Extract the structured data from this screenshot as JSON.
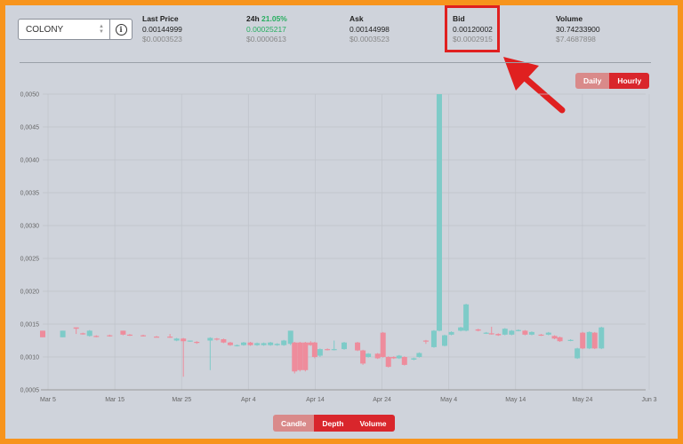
{
  "selector": {
    "value": "COLONY",
    "info_icon": "info-icon"
  },
  "stats": [
    {
      "label": "Last Price",
      "pct": "",
      "value": "0.00144999",
      "usd": "$0.0003523"
    },
    {
      "label": "24h",
      "pct": "21.05%",
      "value": "0.00025217",
      "usd": "$0.0000613"
    },
    {
      "label": "Ask",
      "pct": "",
      "value": "0.00144998",
      "usd": "$0.0003523"
    },
    {
      "label": "Bid",
      "pct": "",
      "value": "0.00120002",
      "usd": "$0.0002915"
    },
    {
      "label": "Volume",
      "pct": "",
      "value": "30.74233900",
      "usd": "$7.4687898"
    }
  ],
  "period_toggle": {
    "daily": "Daily",
    "hourly": "Hourly",
    "active": "Hourly"
  },
  "view_toggle": {
    "candle": "Candle",
    "depth": "Depth",
    "volume": "Volume",
    "active": "Depth"
  },
  "colors": {
    "up": "#7ecbc8",
    "down": "#ee8c9c",
    "accent": "#d9262c",
    "border": "#f7941d"
  },
  "chart_data": {
    "type": "candlestick",
    "y_ticks": [
      "0,0005",
      "0,0010",
      "0,0015",
      "0,0020",
      "0,0025",
      "0,0030",
      "0,0035",
      "0,0040",
      "0,0045",
      "0,0050"
    ],
    "x_ticks": [
      "Mar 5",
      "Mar 15",
      "Mar 25",
      "Apr 4",
      "Apr 14",
      "Apr 24",
      "May 4",
      "May 14",
      "May 24",
      "Jun 3"
    ],
    "ylim": [
      0.0005,
      0.005
    ],
    "xlim": [
      0,
      90
    ],
    "grid": true,
    "candles": [
      {
        "x": 0,
        "o": 0.0014,
        "c": 0.0013,
        "h": 0.0014,
        "l": 0.0013
      },
      {
        "x": 3,
        "o": 0.0013,
        "c": 0.0014,
        "h": 0.0014,
        "l": 0.0013
      },
      {
        "x": 5,
        "o": 0.00145,
        "c": 0.00143,
        "h": 0.00145,
        "l": 0.00135
      },
      {
        "x": 6,
        "o": 0.00136,
        "c": 0.00135,
        "h": 0.00137,
        "l": 0.00134
      },
      {
        "x": 7,
        "o": 0.00132,
        "c": 0.0014,
        "h": 0.00141,
        "l": 0.00131
      },
      {
        "x": 8,
        "o": 0.00132,
        "c": 0.00131,
        "h": 0.00133,
        "l": 0.0013
      },
      {
        "x": 10,
        "o": 0.00133,
        "c": 0.00132,
        "h": 0.00134,
        "l": 0.00131
      },
      {
        "x": 12,
        "o": 0.0014,
        "c": 0.00134,
        "h": 0.0014,
        "l": 0.00133
      },
      {
        "x": 13,
        "o": 0.00134,
        "c": 0.00133,
        "h": 0.00135,
        "l": 0.00132
      },
      {
        "x": 15,
        "o": 0.00133,
        "c": 0.00132,
        "h": 0.00134,
        "l": 0.00131
      },
      {
        "x": 17,
        "o": 0.00131,
        "c": 0.0013,
        "h": 0.00132,
        "l": 0.0013
      },
      {
        "x": 19,
        "o": 0.00131,
        "c": 0.0013,
        "h": 0.00135,
        "l": 0.00129
      },
      {
        "x": 20,
        "o": 0.00125,
        "c": 0.00128,
        "h": 0.00129,
        "l": 0.00124
      },
      {
        "x": 21,
        "o": 0.00128,
        "c": 0.00124,
        "h": 0.00129,
        "l": 0.0007
      },
      {
        "x": 22,
        "o": 0.00124,
        "c": 0.00125,
        "h": 0.00125,
        "l": 0.00123
      },
      {
        "x": 23,
        "o": 0.00123,
        "c": 0.00122,
        "h": 0.00124,
        "l": 0.0012
      },
      {
        "x": 25,
        "o": 0.00125,
        "c": 0.00129,
        "h": 0.0013,
        "l": 0.0008
      },
      {
        "x": 26,
        "o": 0.00128,
        "c": 0.00127,
        "h": 0.00129,
        "l": 0.00125
      },
      {
        "x": 27,
        "o": 0.00127,
        "c": 0.00122,
        "h": 0.00128,
        "l": 0.00121
      },
      {
        "x": 28,
        "o": 0.00122,
        "c": 0.00118,
        "h": 0.00123,
        "l": 0.00117
      },
      {
        "x": 29,
        "o": 0.00117,
        "c": 0.00118,
        "h": 0.00119,
        "l": 0.00116
      },
      {
        "x": 30,
        "o": 0.00118,
        "c": 0.00122,
        "h": 0.00123,
        "l": 0.00117
      },
      {
        "x": 31,
        "o": 0.00122,
        "c": 0.00118,
        "h": 0.00123,
        "l": 0.00117
      },
      {
        "x": 32,
        "o": 0.00118,
        "c": 0.00121,
        "h": 0.00122,
        "l": 0.00117
      },
      {
        "x": 33,
        "o": 0.00118,
        "c": 0.00121,
        "h": 0.00122,
        "l": 0.00117
      },
      {
        "x": 34,
        "o": 0.00118,
        "c": 0.00122,
        "h": 0.00123,
        "l": 0.00117
      },
      {
        "x": 35,
        "o": 0.00118,
        "c": 0.0012,
        "h": 0.00121,
        "l": 0.00117
      },
      {
        "x": 36,
        "o": 0.00118,
        "c": 0.00125,
        "h": 0.00126,
        "l": 0.00117
      },
      {
        "x": 37,
        "o": 0.0012,
        "c": 0.0014,
        "h": 0.0014,
        "l": 0.00118
      },
      {
        "x": 37.6,
        "o": 0.00122,
        "c": 0.00078,
        "h": 0.00123,
        "l": 0.00075
      },
      {
        "x": 38.4,
        "o": 0.00122,
        "c": 0.0008,
        "h": 0.00123,
        "l": 0.00078
      },
      {
        "x": 39.2,
        "o": 0.00122,
        "c": 0.0008,
        "h": 0.00123,
        "l": 0.00078
      },
      {
        "x": 40,
        "o": 0.00122,
        "c": 0.00118,
        "h": 0.00124,
        "l": 0.00117
      },
      {
        "x": 40.6,
        "o": 0.00122,
        "c": 0.001,
        "h": 0.00123,
        "l": 0.00098
      },
      {
        "x": 41.4,
        "o": 0.00102,
        "c": 0.00112,
        "h": 0.00113,
        "l": 0.001
      },
      {
        "x": 42.5,
        "o": 0.00112,
        "c": 0.00111,
        "h": 0.00113,
        "l": 0.0011
      },
      {
        "x": 43.5,
        "o": 0.00111,
        "c": 0.00112,
        "h": 0.00125,
        "l": 0.0011
      },
      {
        "x": 45,
        "o": 0.00112,
        "c": 0.00122,
        "h": 0.00123,
        "l": 0.00111
      },
      {
        "x": 47,
        "o": 0.00122,
        "c": 0.0011,
        "h": 0.00123,
        "l": 0.00109
      },
      {
        "x": 47.8,
        "o": 0.0011,
        "c": 0.0009,
        "h": 0.00111,
        "l": 0.00088
      },
      {
        "x": 48.6,
        "o": 0.001,
        "c": 0.00105,
        "h": 0.00106,
        "l": 0.00099
      },
      {
        "x": 50,
        "o": 0.00105,
        "c": 0.00098,
        "h": 0.00106,
        "l": 0.00097
      },
      {
        "x": 50.8,
        "o": 0.00137,
        "c": 0.001,
        "h": 0.00138,
        "l": 0.00099
      },
      {
        "x": 51.6,
        "o": 0.001,
        "c": 0.00085,
        "h": 0.00101,
        "l": 0.00084
      },
      {
        "x": 52.4,
        "o": 0.001,
        "c": 0.00098,
        "h": 0.00101,
        "l": 0.00097
      },
      {
        "x": 53.2,
        "o": 0.00098,
        "c": 0.00102,
        "h": 0.00103,
        "l": 0.00097
      },
      {
        "x": 54,
        "o": 0.001,
        "c": 0.00088,
        "h": 0.00101,
        "l": 0.00087
      },
      {
        "x": 55.4,
        "o": 0.00096,
        "c": 0.00098,
        "h": 0.00099,
        "l": 0.00095
      },
      {
        "x": 56.2,
        "o": 0.001,
        "c": 0.00106,
        "h": 0.00107,
        "l": 0.00099
      },
      {
        "x": 57.2,
        "o": 0.00125,
        "c": 0.00124,
        "h": 0.00126,
        "l": 0.0012
      },
      {
        "x": 58.4,
        "o": 0.00115,
        "c": 0.0014,
        "h": 0.00141,
        "l": 0.00114
      },
      {
        "x": 59.2,
        "o": 0.0014,
        "c": 0.005,
        "h": 0.005,
        "l": 0.00139
      },
      {
        "x": 60,
        "o": 0.00117,
        "c": 0.00133,
        "h": 0.00134,
        "l": 0.00116
      },
      {
        "x": 61,
        "o": 0.00134,
        "c": 0.00138,
        "h": 0.00139,
        "l": 0.00133
      },
      {
        "x": 62.4,
        "o": 0.0014,
        "c": 0.00145,
        "h": 0.00146,
        "l": 0.00139
      },
      {
        "x": 63.2,
        "o": 0.0014,
        "c": 0.0018,
        "h": 0.00181,
        "l": 0.00139
      },
      {
        "x": 65,
        "o": 0.00142,
        "c": 0.0014,
        "h": 0.00143,
        "l": 0.00139
      },
      {
        "x": 66.2,
        "o": 0.00136,
        "c": 0.00137,
        "h": 0.00138,
        "l": 0.00135
      },
      {
        "x": 67,
        "o": 0.00136,
        "c": 0.00135,
        "h": 0.00146,
        "l": 0.00134
      },
      {
        "x": 68,
        "o": 0.00135,
        "c": 0.00133,
        "h": 0.00136,
        "l": 0.00132
      },
      {
        "x": 69,
        "o": 0.00134,
        "c": 0.00143,
        "h": 0.00144,
        "l": 0.00133
      },
      {
        "x": 70,
        "o": 0.00134,
        "c": 0.0014,
        "h": 0.00141,
        "l": 0.00133
      },
      {
        "x": 71,
        "o": 0.0014,
        "c": 0.00141,
        "h": 0.00142,
        "l": 0.00139
      },
      {
        "x": 72,
        "o": 0.0014,
        "c": 0.00134,
        "h": 0.00141,
        "l": 0.00133
      },
      {
        "x": 73,
        "o": 0.00134,
        "c": 0.00138,
        "h": 0.00139,
        "l": 0.00133
      },
      {
        "x": 74.4,
        "o": 0.00134,
        "c": 0.00133,
        "h": 0.00135,
        "l": 0.00132
      },
      {
        "x": 75.5,
        "o": 0.00134,
        "c": 0.00137,
        "h": 0.00138,
        "l": 0.00133
      },
      {
        "x": 76.4,
        "o": 0.00132,
        "c": 0.00128,
        "h": 0.00133,
        "l": 0.00127
      },
      {
        "x": 77.2,
        "o": 0.0013,
        "c": 0.00124,
        "h": 0.00131,
        "l": 0.00123
      },
      {
        "x": 78.8,
        "o": 0.00125,
        "c": 0.00126,
        "h": 0.00127,
        "l": 0.00124
      },
      {
        "x": 79.8,
        "o": 0.00098,
        "c": 0.00113,
        "h": 0.00114,
        "l": 0.00097
      },
      {
        "x": 80.6,
        "o": 0.00137,
        "c": 0.00113,
        "h": 0.00138,
        "l": 0.00112
      },
      {
        "x": 81.6,
        "o": 0.00113,
        "c": 0.00138,
        "h": 0.00139,
        "l": 0.00112
      },
      {
        "x": 82.4,
        "o": 0.00137,
        "c": 0.00113,
        "h": 0.00138,
        "l": 0.00112
      },
      {
        "x": 83.4,
        "o": 0.00113,
        "c": 0.00145,
        "h": 0.00146,
        "l": 0.00112
      }
    ]
  }
}
